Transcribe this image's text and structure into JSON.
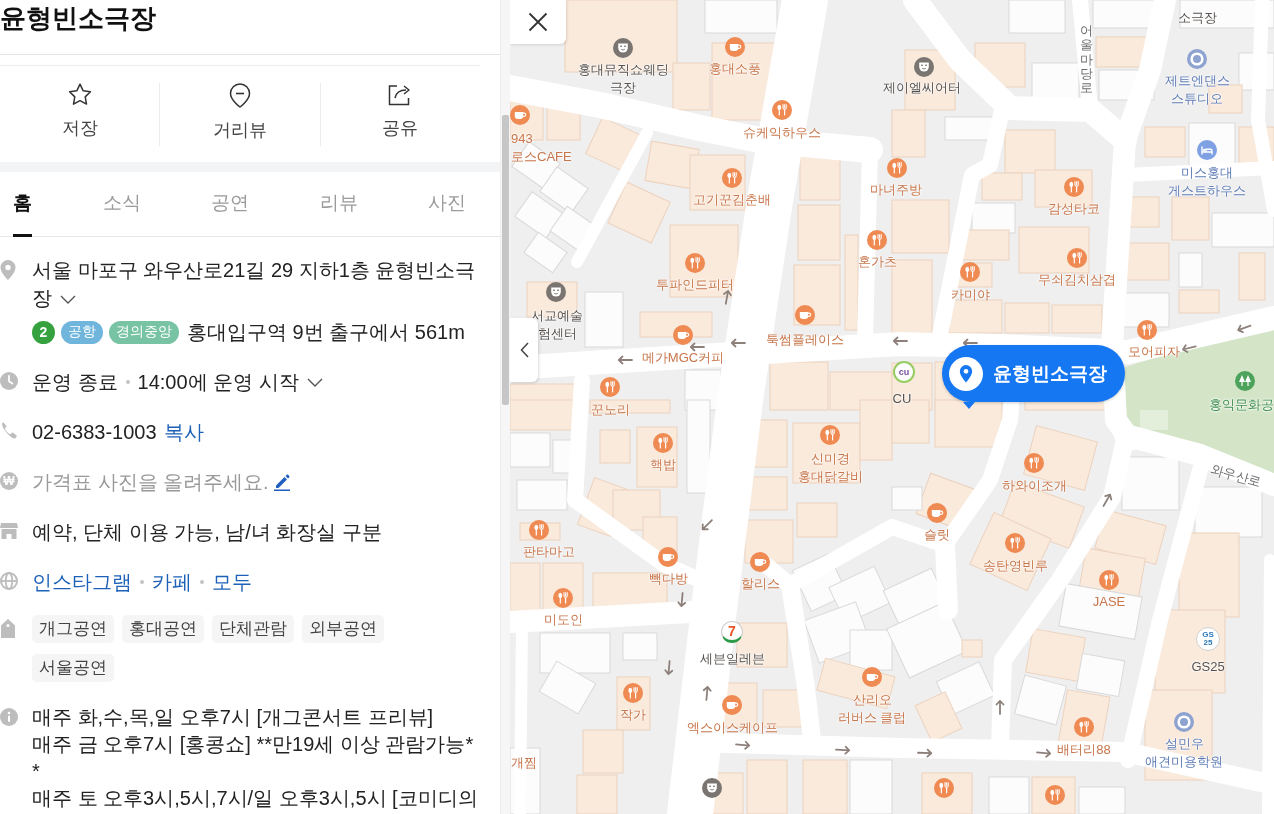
{
  "place": {
    "title": "윤형빈소극장"
  },
  "actions": [
    {
      "kind": "save",
      "label": "저장"
    },
    {
      "kind": "street_view",
      "label": "거리뷰"
    },
    {
      "kind": "share",
      "label": "공유"
    }
  ],
  "tabs": [
    {
      "label": "홈",
      "selected": true
    },
    {
      "label": "소식",
      "selected": false
    },
    {
      "label": "공연",
      "selected": false
    },
    {
      "label": "리뷰",
      "selected": false
    },
    {
      "label": "사진",
      "selected": false
    }
  ],
  "info": {
    "address": {
      "text": "서울 마포구 와우산로21길 29 지하1층 윤형빈소극장",
      "expanded": false
    },
    "transit": {
      "lines": [
        {
          "label": "2",
          "kind": "circle",
          "color": "#35a23f"
        },
        {
          "label": "공항",
          "kind": "pill",
          "color": "#6fb5dc"
        },
        {
          "label": "경의중앙",
          "kind": "pill",
          "color": "#79c3a5"
        }
      ],
      "directions": "홍대입구역 9번 출구에서 561m"
    },
    "hours": {
      "status": "운영 종료",
      "next": "14:00에 운영 시작",
      "expanded": false
    },
    "phone": {
      "number": "02-6383-1003",
      "copy": "복사"
    },
    "price": {
      "symbol": "₩",
      "prompt": "가격표 사진을 올려주세요."
    },
    "facilities": "예약, 단체 이용 가능, 남/녀 화장실 구분",
    "links": [
      "인스타그램",
      "카페",
      "모두"
    ],
    "tags": [
      "개그공연",
      "홍대공연",
      "단체관람",
      "외부공연",
      "서울공연"
    ],
    "notice": [
      "매주 화,수,목,일 오후7시 [개그콘서트 프리뷰]",
      "매주 금 오후7시 [홍콩쇼] **만19세 이상 관람가능*",
      "*",
      "매주 토 오후3시,5시,7시/일 오후3시,5시 [코미디의"
    ]
  },
  "map": {
    "pois": [
      {
        "kind": "theater",
        "lines": [
          "소극장"
        ]
      },
      {
        "kind": "theater",
        "lines": [
          "홍대뮤직쇼웨딩",
          "극장"
        ]
      },
      {
        "kind": "cafe",
        "lines": [
          "홍대소풍"
        ]
      },
      {
        "kind": "theater",
        "lines": [
          "제이엘씨어터"
        ]
      },
      {
        "kind": "dance",
        "lines": [
          "제트엔댄스",
          "스튜디오"
        ]
      },
      {
        "kind": "cafe",
        "lines": [
          "943",
          "로스CAFE"
        ]
      },
      {
        "kind": "restaurant",
        "lines": [
          "슈케익하우스"
        ]
      },
      {
        "kind": "restaurant",
        "lines": [
          "고기꾼김춘배"
        ]
      },
      {
        "kind": "restaurant",
        "lines": [
          "마녀주방"
        ]
      },
      {
        "kind": "restaurant",
        "lines": [
          "감성타코"
        ]
      },
      {
        "kind": "lodging",
        "lines": [
          "미스홍대",
          "게스트하우스"
        ]
      },
      {
        "kind": "restaurant",
        "lines": [
          "혼가츠"
        ]
      },
      {
        "kind": "restaurant",
        "lines": [
          "투파인드피터"
        ]
      },
      {
        "kind": "restaurant",
        "lines": [
          "카미야"
        ]
      },
      {
        "kind": "restaurant",
        "lines": [
          "무쇠김치삼겹"
        ]
      },
      {
        "kind": "theater",
        "lines": [
          "서교예술",
          "험센터"
        ]
      },
      {
        "kind": "cafe",
        "lines": [
          "메가MGC커피"
        ]
      },
      {
        "kind": "cafe",
        "lines": [
          "툭썸플레이스"
        ]
      },
      {
        "kind": "restaurant",
        "lines": [
          "모어피자"
        ]
      },
      {
        "kind": "restaurant",
        "lines": [
          "꾼노리"
        ]
      },
      {
        "kind": "store_cu",
        "logo_text": "cu",
        "lines": [
          "CU"
        ]
      },
      {
        "kind": "park",
        "lines": [
          "홍익문화공"
        ]
      },
      {
        "kind": "restaurant",
        "lines": [
          "핵밥"
        ]
      },
      {
        "kind": "restaurant",
        "lines": [
          "신미경",
          "홍대닭갈비"
        ]
      },
      {
        "kind": "restaurant",
        "lines": [
          "하와이조개"
        ]
      },
      {
        "kind": "restaurant",
        "lines": [
          "판타마고"
        ]
      },
      {
        "kind": "cafe",
        "lines": [
          "슬릿"
        ]
      },
      {
        "kind": "cafe",
        "lines": [
          "빽다방"
        ]
      },
      {
        "kind": "cafe",
        "lines": [
          "할리스"
        ]
      },
      {
        "kind": "restaurant",
        "lines": [
          "송탄영빈루"
        ]
      },
      {
        "kind": "restaurant",
        "lines": [
          "미도인"
        ]
      },
      {
        "kind": "restaurant",
        "lines": [
          "JASE"
        ]
      },
      {
        "kind": "store_711",
        "logo_text": "7",
        "lines": [
          "세븐일레븐"
        ]
      },
      {
        "kind": "store_gs",
        "logo_text": "GS25",
        "lines": [
          "GS25"
        ]
      },
      {
        "kind": "restaurant",
        "lines": [
          "작가"
        ]
      },
      {
        "kind": "cafe",
        "lines": [
          "엑스이스케이프"
        ]
      },
      {
        "kind": "cafe",
        "lines": [
          "산리오",
          "러버스 클럽"
        ]
      },
      {
        "kind": "restaurant",
        "lines": [
          "개찜"
        ]
      },
      {
        "kind": "restaurant",
        "lines": [
          "배터리88"
        ]
      },
      {
        "kind": "dance",
        "lines": [
          "설민우",
          "애견미용학원"
        ]
      },
      {
        "kind": "theater"
      },
      {
        "kind": "restaurant"
      },
      {
        "kind": "restaurant"
      }
    ],
    "road_labels": [
      {
        "name": "어울마당로",
        "kind": "vertical"
      },
      {
        "name": "와우산로",
        "kind": "angled"
      }
    ],
    "selected_place": {
      "name": "윤형빈소극장"
    }
  }
}
